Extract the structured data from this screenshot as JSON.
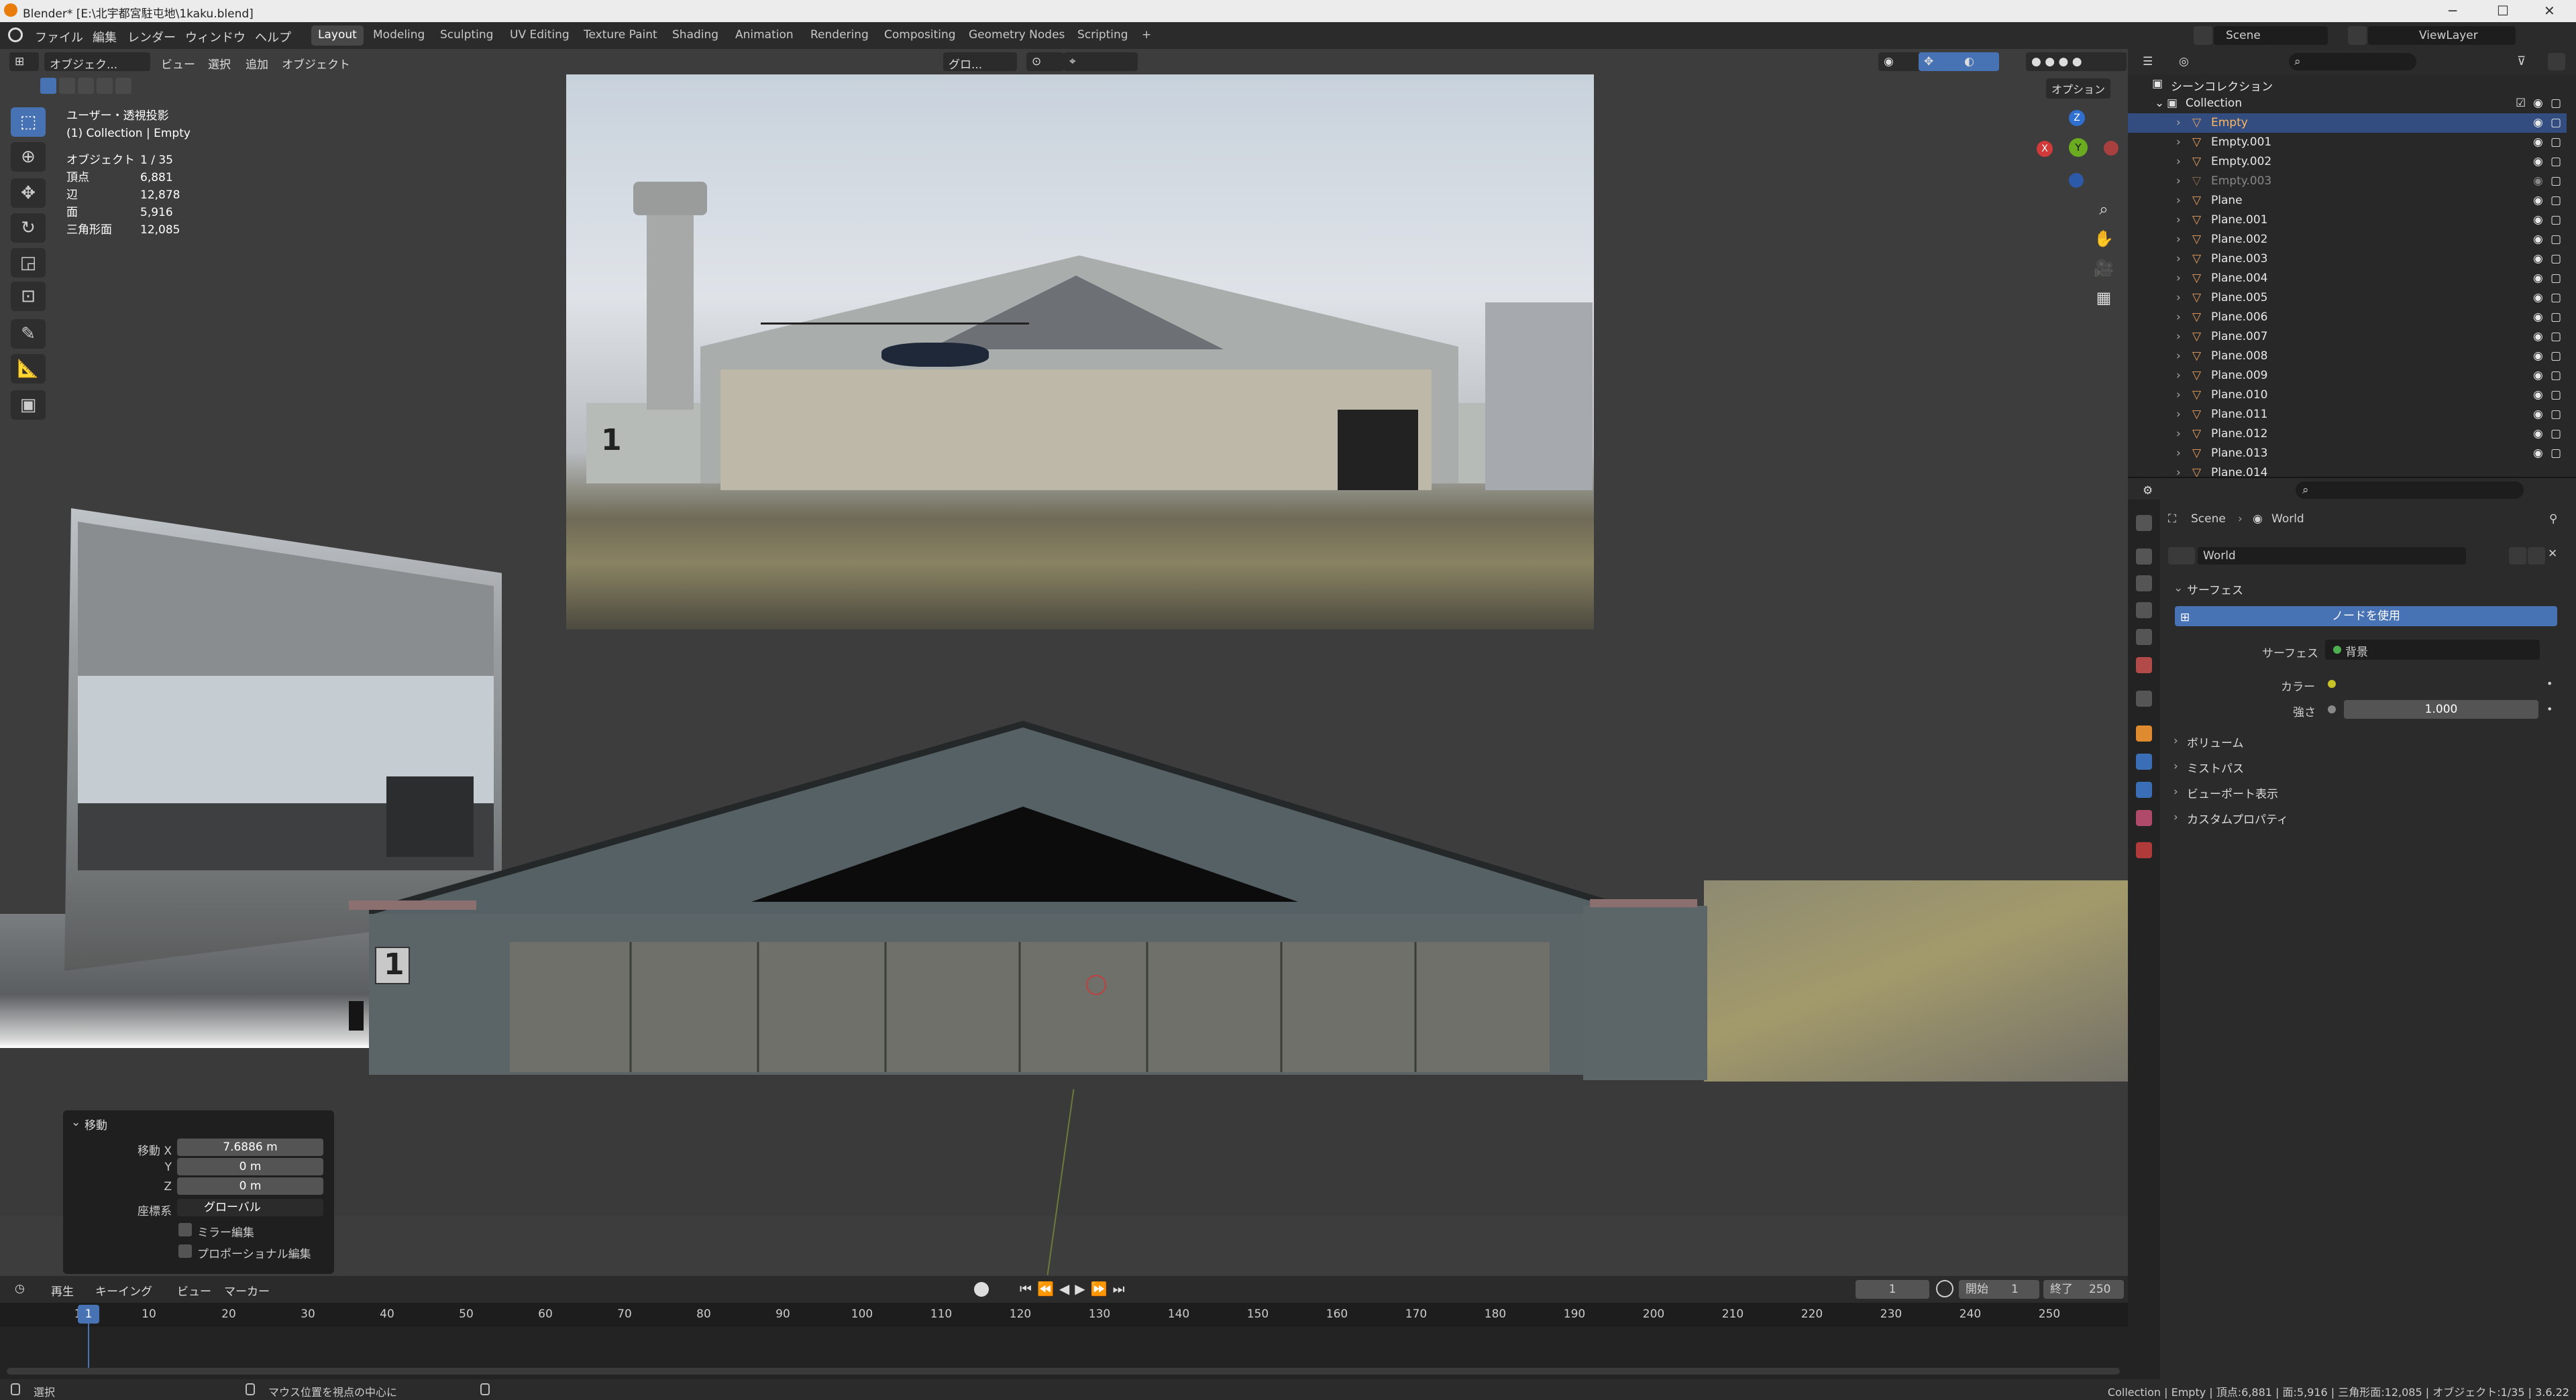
{
  "titlebar": {
    "title": "Blender* [E:\\北宇都宮駐屯地\\1kaku.blend]",
    "minimize": "─",
    "maximize": "☐",
    "close": "✕"
  },
  "menu": {
    "items": [
      "ファイル",
      "編集",
      "レンダー",
      "ウィンドウ",
      "ヘルプ"
    ]
  },
  "workspaces": {
    "tabs": [
      "Layout",
      "Modeling",
      "Sculpting",
      "UV Editing",
      "Texture Paint",
      "Shading",
      "Animation",
      "Rendering",
      "Compositing",
      "Geometry Nodes",
      "Scripting",
      "+"
    ],
    "active": "Layout"
  },
  "scene": {
    "scene_name": "Scene",
    "view_layer": "ViewLayer"
  },
  "viewport": {
    "mode": "オブジェク...",
    "menus": [
      "ビュー",
      "選択",
      "追加",
      "オブジェクト"
    ],
    "transform": "グロ...",
    "options": "オプション",
    "view_name": "ユーザー・透視投影",
    "collection": "(1) Collection | Empty",
    "stats": [
      {
        "label": "オブジェクト",
        "value": "1 / 35"
      },
      {
        "label": "頂点",
        "value": "6,881"
      },
      {
        "label": "辺",
        "value": "12,878"
      },
      {
        "label": "面",
        "value": "5,916"
      },
      {
        "label": "三角形面",
        "value": "12,085"
      }
    ],
    "hangar_number": "1",
    "gizmo": {
      "x": "X",
      "y": "Y",
      "z": "Z"
    }
  },
  "operator": {
    "title": "移動",
    "move_x_label": "移動 X",
    "move_x": "7.6886 m",
    "y_label": "Y",
    "y": "0 m",
    "z_label": "Z",
    "z": "0 m",
    "orient_label": "座標系",
    "orient": "グローバル",
    "mirror": "ミラー編集",
    "proportional": "プロポーショナル編集"
  },
  "timeline": {
    "menus": [
      "再生",
      "キーイング",
      "ビュー",
      "マーカー"
    ],
    "current_frame": "1",
    "start_label": "開始",
    "start": "1",
    "end_label": "終了",
    "end": "250",
    "ticks": [
      "1",
      "10",
      "20",
      "30",
      "40",
      "50",
      "60",
      "70",
      "80",
      "90",
      "100",
      "110",
      "120",
      "130",
      "140",
      "150",
      "160",
      "170",
      "180",
      "190",
      "200",
      "210",
      "220",
      "230",
      "240",
      "250"
    ]
  },
  "statusbar": {
    "left": "選択",
    "middle": "マウス位置を視点の中心に",
    "right": "Collection | Empty | 頂点:6,881 | 面:5,916 | 三角形面:12,085 | オブジェクト:1/35 | 3.6.22"
  },
  "outliner": {
    "root": "シーンコレクション",
    "collection": "Collection",
    "items": [
      "Empty",
      "Empty.001",
      "Empty.002",
      "Empty.003",
      "Plane",
      "Plane.001",
      "Plane.002",
      "Plane.003",
      "Plane.004",
      "Plane.005",
      "Plane.006",
      "Plane.007",
      "Plane.008",
      "Plane.009",
      "Plane.010",
      "Plane.011",
      "Plane.012",
      "Plane.013",
      "Plane.014"
    ],
    "selected": "Empty"
  },
  "properties": {
    "breadcrumb_scene": "Scene",
    "breadcrumb_world": "World",
    "world_name": "World",
    "surface_section": "サーフェス",
    "use_nodes": "ノードを使用",
    "surface_label": "サーフェス",
    "surface_value": "背景",
    "color_label": "カラー",
    "strength_label": "強さ",
    "strength_value": "1.000",
    "sections": [
      "ボリューム",
      "ミストパス",
      "ビューポート表示",
      "カスタムプロパティ"
    ]
  },
  "colors": {
    "accent": "#4772b3",
    "selection": "#334d80",
    "background": "#3d3d3d"
  }
}
